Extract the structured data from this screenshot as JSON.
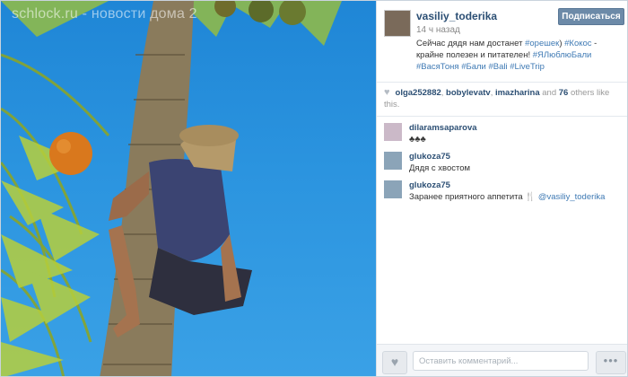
{
  "watermark": "schlock.ru - новости дома 2",
  "post": {
    "username": "vasiliy_toderika",
    "time": "14 ч назад",
    "follow_label": "Подписаться",
    "caption_parts": [
      "Сейчас дядя нам достанет ",
      "#орешек",
      ") ",
      "#Кокос",
      " - крайне полезен и питателен! ",
      "#ЯЛюблюБали",
      " ",
      "#ВасяТоня",
      " ",
      "#Бали",
      " ",
      "#Bali",
      " ",
      "#LiveTrip"
    ]
  },
  "likes": {
    "users": [
      "olga252882",
      "bobylevatv",
      "imazharina"
    ],
    "sep": ", ",
    "and": "and",
    "count": "76",
    "suffix": "others like this."
  },
  "comments": [
    {
      "name": "dilaramsaparova",
      "text": "♣♣♣"
    },
    {
      "name": "glukoza75",
      "text": "Дядя с хвостом"
    },
    {
      "name": "glukoza75",
      "text": "Заранее приятного аппетита 🍴 ",
      "mention": "@vasiliy_toderika"
    }
  ],
  "footer": {
    "comment_placeholder": "Оставить комментарий...",
    "like_icon": "heart-icon",
    "more_label": "•••"
  },
  "colors": {
    "link": "#3f7ab4",
    "username": "#2c4f74",
    "follow_bg": "#6c8aa8",
    "sky": "#2b94df"
  }
}
